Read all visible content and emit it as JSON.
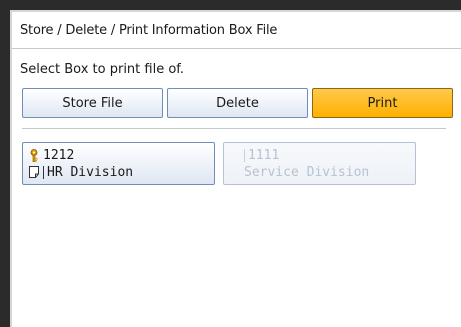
{
  "screen": {
    "title": "Store / Delete / Print Information Box File",
    "instruction": "Select Box to print file of."
  },
  "tabs": [
    {
      "label": "Store File",
      "active": false
    },
    {
      "label": "Delete",
      "active": false
    },
    {
      "label": "Print",
      "active": true
    }
  ],
  "boxes": [
    {
      "number": "1212",
      "name": "HR Division",
      "enabled": true,
      "icons": [
        "key-icon",
        "document-icon"
      ]
    },
    {
      "number": "1111",
      "name": "Service Division",
      "enabled": false
    }
  ],
  "colors": {
    "active_tab": "#ffb000",
    "button_border": "#6f8fb8",
    "disabled_text": "#b8c3d1"
  }
}
